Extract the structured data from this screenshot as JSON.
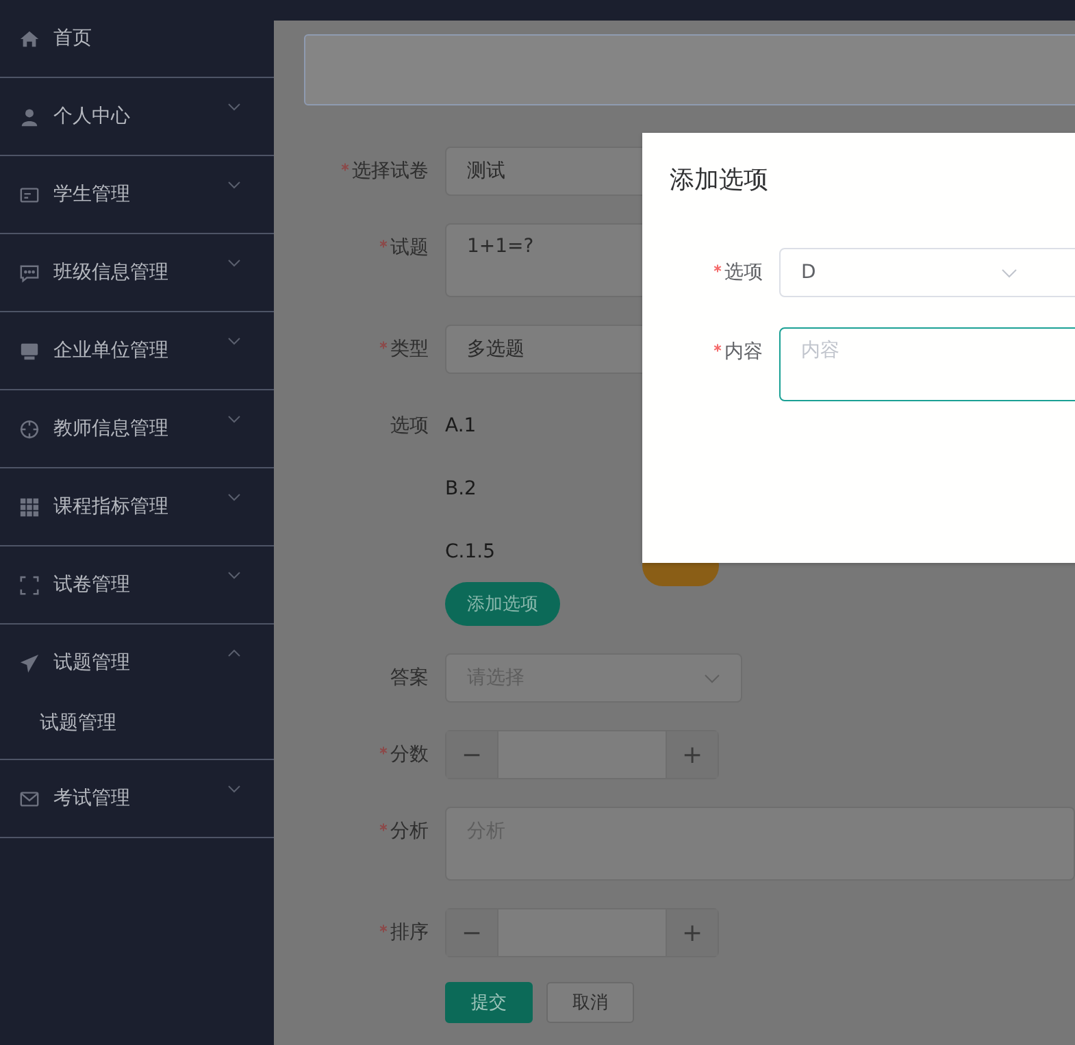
{
  "sidebar": {
    "items": [
      {
        "label": "首页"
      },
      {
        "label": "个人中心",
        "expanded": false
      },
      {
        "label": "学生管理",
        "expanded": false
      },
      {
        "label": "班级信息管理",
        "expanded": false
      },
      {
        "label": "企业单位管理",
        "expanded": false
      },
      {
        "label": "教师信息管理",
        "expanded": false
      },
      {
        "label": "课程指标管理",
        "expanded": false
      },
      {
        "label": "试卷管理",
        "expanded": false
      },
      {
        "label": "试题管理",
        "expanded": true,
        "children": [
          {
            "label": "试题管理"
          }
        ]
      },
      {
        "label": "考试管理",
        "expanded": false
      }
    ]
  },
  "form": {
    "fields": [
      {
        "kind": "select",
        "label": "选择试卷",
        "required": true,
        "value": "测试"
      },
      {
        "kind": "textarea",
        "label": "试题",
        "required": true,
        "value": "1+1=?"
      },
      {
        "kind": "select",
        "label": "类型",
        "required": true,
        "value": "多选题"
      },
      {
        "kind": "options",
        "label": "选项",
        "required": false,
        "items": [
          "A.1",
          "B.2",
          "C.1.5"
        ],
        "add_button": "添加选项"
      },
      {
        "kind": "select",
        "label": "答案",
        "required": false,
        "placeholder": "请选择",
        "chevron": true
      },
      {
        "kind": "number",
        "label": "分数",
        "required": true,
        "minus": "−",
        "plus": "+"
      },
      {
        "kind": "textarea",
        "label": "分析",
        "required": true,
        "placeholder": "分析"
      },
      {
        "kind": "number",
        "label": "排序",
        "required": true,
        "minus": "−",
        "plus": "+"
      }
    ],
    "buttons": [
      {
        "label": "提交",
        "kind": "primary"
      },
      {
        "label": "取消",
        "kind": "plain"
      }
    ]
  },
  "dialog": {
    "title": "添加选项",
    "fields": [
      {
        "kind": "select",
        "label": "选项",
        "required": true,
        "value": "D"
      },
      {
        "kind": "textarea",
        "label": "内容",
        "required": true,
        "placeholder": "内容",
        "focused": true
      }
    ]
  }
}
